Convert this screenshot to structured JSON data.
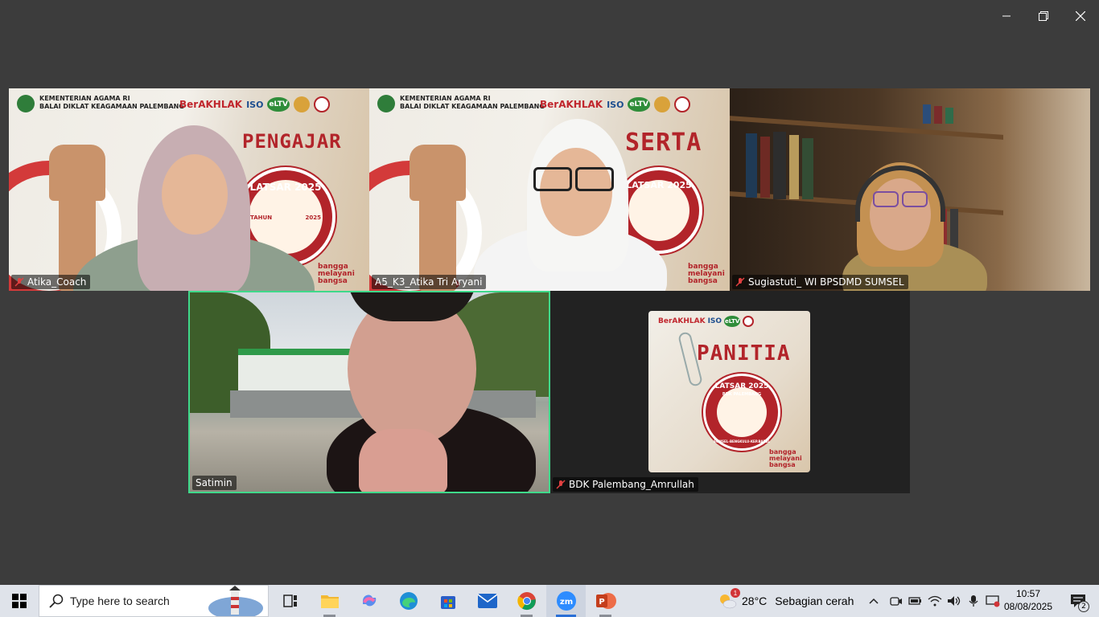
{
  "tiles": [
    {
      "name": "Atika_Coach",
      "muted": true,
      "slide_word": "PENGAJAR"
    },
    {
      "name": "A5_K3_Atika Tri Aryani",
      "muted": false,
      "slide_word": "SERTA"
    },
    {
      "name": "Sugiastuti_ WI BPSDMD SUMSEL",
      "muted": true
    },
    {
      "name": "Satimin",
      "muted": false,
      "active_speaker": true
    },
    {
      "name": "BDK Palembang_Amrullah",
      "muted": true,
      "slide_word": "PANITIA"
    }
  ],
  "slide": {
    "ministry_line1": "KEMENTERIAN AGAMA RI",
    "ministry_line2": "BALAI DIKLAT KEAGAMAAN PALEMBANG",
    "berakhlak": "BerAKHLAK",
    "iso": "ISO",
    "eltv": "eLTV",
    "latsar": "LATSAR 2025",
    "bdk": "BDK PALEMBANG",
    "tahun": "TAHUN",
    "year": "2025",
    "region": "SUMSEL-BENGKULU-KEP.BABEL",
    "tagline1": "bangga",
    "tagline2": "melayani",
    "tagline3": "bangsa"
  },
  "taskbar": {
    "search_placeholder": "Type here to search",
    "apps": [
      "task-view",
      "file-explorer",
      "copilot",
      "edge",
      "microsoft-store",
      "mail",
      "chrome",
      "zoom",
      "powerpoint"
    ],
    "weather_temp": "28°C",
    "weather_desc": "Sebagian cerah",
    "weather_alert": "1",
    "time": "10:57",
    "date": "08/08/2025",
    "notification_count": "2"
  },
  "colors": {
    "background": "#3c3c3c",
    "active_speaker_border": "#3fd98a",
    "slide_red": "#b2242a",
    "taskbar": "#dfe3ea"
  }
}
